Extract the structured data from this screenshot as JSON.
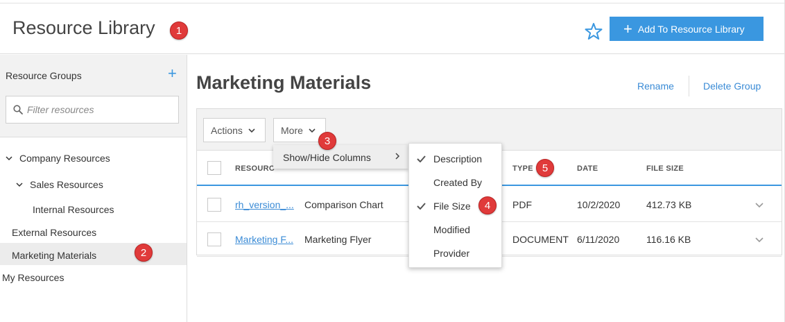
{
  "header": {
    "title": "Resource Library",
    "add_button_label": "Add To Resource Library",
    "add_button_icon": "plus-icon",
    "favorite_icon": "star-icon"
  },
  "annotations": [
    "1",
    "2",
    "3",
    "4",
    "5"
  ],
  "sidebar": {
    "title": "Resource Groups",
    "add_icon": "+",
    "filter_placeholder": "Filter resources",
    "tree": [
      {
        "label": "Company Resources",
        "expanded": true
      },
      {
        "label": "Sales Resources",
        "expanded": true
      },
      {
        "label": "Internal Resources"
      },
      {
        "label": "External Resources"
      },
      {
        "label": "Marketing Materials",
        "selected": true
      },
      {
        "label": "My Resources"
      }
    ]
  },
  "main": {
    "group_title": "Marketing Materials",
    "rename_label": "Rename",
    "delete_label": "Delete Group",
    "toolbar": {
      "actions_label": "Actions",
      "more_label": "More"
    },
    "columns": {
      "resource": "RESOURC",
      "type": "TYPE",
      "date": "DATE",
      "file_size": "FILE SIZE"
    },
    "rows": [
      {
        "resource": "rh_version_...",
        "description": "Comparison Chart",
        "type": "PDF",
        "date": "10/2/2020",
        "file_size": "412.73 KB"
      },
      {
        "resource": "Marketing F...",
        "description": "Marketing Flyer",
        "type": "DOCUMENT",
        "date": "6/11/2020",
        "file_size": "116.16 KB"
      }
    ]
  },
  "more_menu": {
    "item_label": "Show/Hide Columns",
    "submenu": [
      {
        "label": "Description",
        "checked": true
      },
      {
        "label": "Created By",
        "checked": false
      },
      {
        "label": "File Size",
        "checked": true
      },
      {
        "label": "Modified",
        "checked": false
      },
      {
        "label": "Provider",
        "checked": false
      }
    ]
  },
  "colors": {
    "accent": "#3a97e0",
    "link": "#3a8bd6",
    "badge": "#e03a3a"
  }
}
